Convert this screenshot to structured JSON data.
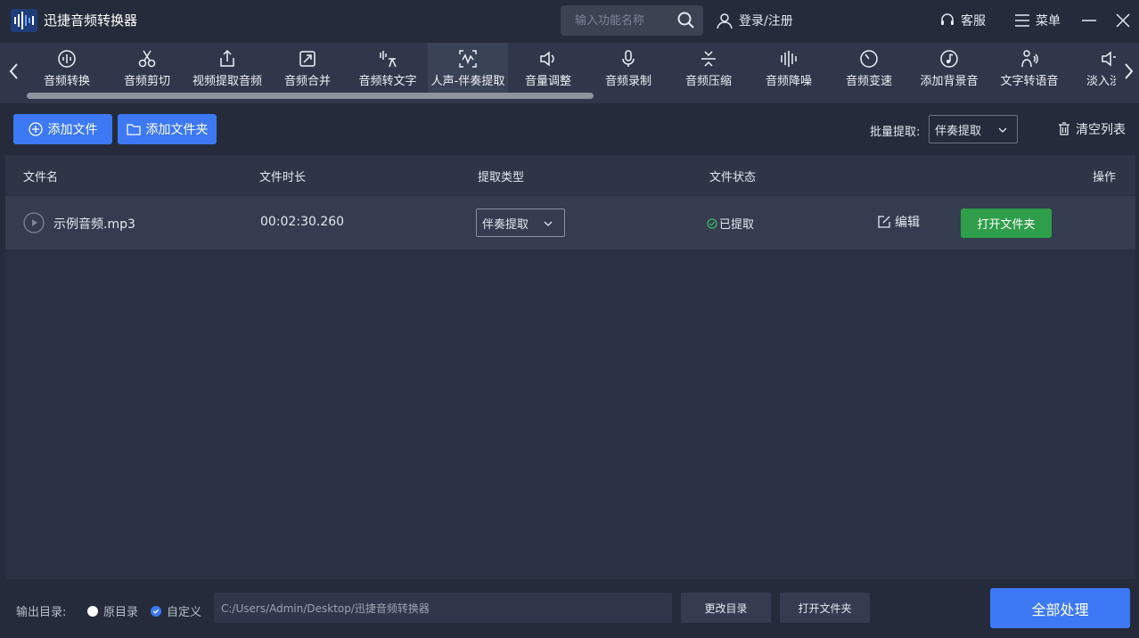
{
  "app": {
    "title": "迅捷音频转换器",
    "search_placeholder": "输入功能名称",
    "login_label": "登录/注册",
    "service_label": "客服",
    "menu_label": "菜单"
  },
  "toolbar": {
    "tools": [
      {
        "label": "音频转换",
        "icon": "audio-convert-icon"
      },
      {
        "label": "音频剪切",
        "icon": "scissors-icon"
      },
      {
        "label": "视频提取音频",
        "icon": "export-icon"
      },
      {
        "label": "音频合并",
        "icon": "merge-icon"
      },
      {
        "label": "音频转文字",
        "icon": "speech-to-text-icon"
      },
      {
        "label": "人声-伴奏提取",
        "icon": "vocal-separation-icon",
        "active": true
      },
      {
        "label": "音量调整",
        "icon": "volume-icon"
      },
      {
        "label": "音频录制",
        "icon": "microphone-icon"
      },
      {
        "label": "音频压缩",
        "icon": "compress-icon"
      },
      {
        "label": "音频降噪",
        "icon": "noise-reduction-icon"
      },
      {
        "label": "音频变速",
        "icon": "speed-icon"
      },
      {
        "label": "添加背景音",
        "icon": "music-note-icon"
      },
      {
        "label": "文字转语音",
        "icon": "text-to-speech-icon"
      },
      {
        "label": "淡入淡出",
        "icon": "fade-icon"
      }
    ]
  },
  "actions": {
    "add_file": "添加文件",
    "add_folder": "添加文件夹",
    "batch_label": "批量提取:",
    "batch_value": "伴奏提取",
    "clear_list": "清空列表"
  },
  "table": {
    "headers": {
      "name": "文件名",
      "duration": "文件时长",
      "type": "提取类型",
      "status": "文件状态",
      "ops": "操作"
    },
    "rows": [
      {
        "name": "示例音频.mp3",
        "duration": "00:02:30.260",
        "type": "伴奏提取",
        "status": "已提取",
        "edit": "编辑",
        "open": "打开文件夹"
      }
    ]
  },
  "footer": {
    "output_label": "输出目录:",
    "option_original": "原目录",
    "option_custom": "自定义",
    "custom_selected": true,
    "path": "C:/Users/Admin/Desktop/迅捷音频转换器",
    "change_dir": "更改目录",
    "open_folder": "打开文件夹",
    "process_all": "全部处理"
  },
  "colors": {
    "accent": "#3d78f5",
    "success": "#2e9e4a",
    "background": "#252b3a"
  }
}
